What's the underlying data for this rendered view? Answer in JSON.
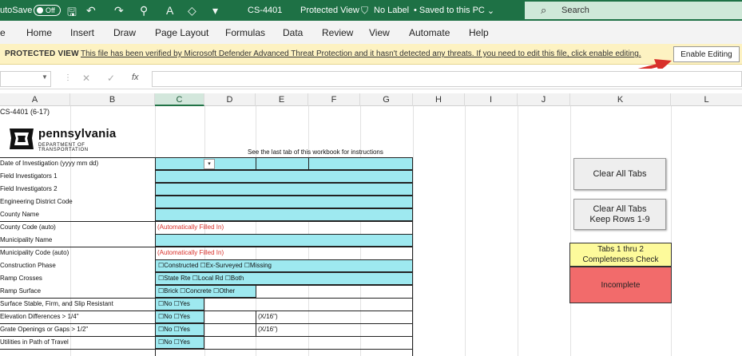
{
  "titlebar": {
    "autosave_label": "utoSave",
    "autosave_state": "Off",
    "doc_name": "CS-4401",
    "protected": "Protected View",
    "label": "No Label",
    "saved": "Saved to this PC",
    "saved_caret": "⌄",
    "search_placeholder": "Search"
  },
  "ribbon": {
    "tabs": [
      "e",
      "Home",
      "Insert",
      "Draw",
      "Page Layout",
      "Formulas",
      "Data",
      "Review",
      "View",
      "Automate",
      "Help"
    ]
  },
  "protected_view": {
    "label": "PROTECTED VIEW",
    "message": "This file has been verified by Microsoft Defender Advanced Threat Protection and it hasn't detected any threats. If you need to edit this file, click enable editing.",
    "button": "Enable Editing"
  },
  "formula_bar": {
    "fx": "fx",
    "dropdown": "▼",
    "separator": "⋮",
    "cancel_icon": "✕",
    "confirm_icon": "✓"
  },
  "columns": [
    "A",
    "B",
    "C",
    "D",
    "E",
    "F",
    "G",
    "H",
    "I",
    "J",
    "K",
    "L"
  ],
  "sheet": {
    "form_id": "CS-4401 (6-17)",
    "logo_title": "pennsylvania",
    "logo_subtitle": "DEPARTMENT OF TRANSPORTATION",
    "instructions": "See the last tab of this workbook for instructions",
    "dropdown_caret": "▾",
    "rows": [
      "Date of Investigation (yyyy mm dd)",
      "Field Investigators 1",
      "Field Investigators 2",
      "Engineering District Code",
      "County Name",
      "County Code (auto)",
      "Municipality Name",
      "Municipality Code (auto)",
      "Construction Phase",
      "Ramp Crosses",
      "Ramp Surface",
      "Surface Stable, Firm, and Slip Resistant",
      "Elevation Differences > 1/4\"",
      "Grate Openings or Gaps > 1/2\"",
      "Utilities in Path of Travel"
    ],
    "auto_filled": "(Automatically Filled In)",
    "construction_options": "☐Constructed   ☐Ex-Surveyed   ☐Missing",
    "ramp_crosses_options": "☐State Rte   ☐Local Rd   ☐Both",
    "ramp_surface_options": "☐Brick ☐Concrete ☐Other",
    "yes_no": "☐No  ☐Yes",
    "x16": "(X/16\")"
  },
  "buttons": {
    "clear_all": "Clear All Tabs",
    "clear_keep_1": "Clear All Tabs",
    "clear_keep_2": "Keep Rows 1-9"
  },
  "completeness": {
    "label_1": "Tabs 1 thru 2",
    "label_2": "Completeness Check",
    "status": "Incomplete",
    "label_color": "#fdfa9b",
    "status_color": "#f26b6b"
  },
  "colors": {
    "excel_green": "#1e7145",
    "input_cyan": "#9ee9f0",
    "arrow_red": "#d8302a"
  }
}
